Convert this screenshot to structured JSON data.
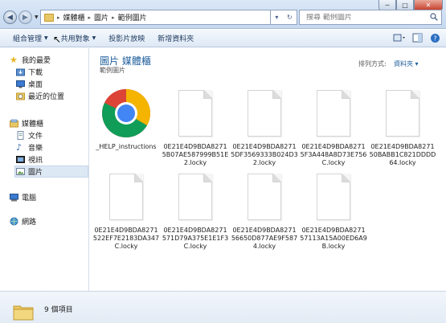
{
  "window": {
    "minimize": "─",
    "maximize": "□",
    "close": "✕"
  },
  "address": {
    "crumbs": [
      "媒體櫃",
      "圖片",
      "範例圖片"
    ],
    "separator": "▸",
    "dropdown": "▾",
    "refresh": "↻"
  },
  "search": {
    "placeholder": "搜尋 範例圖片"
  },
  "commandbar": {
    "organize": "組合管理",
    "share": "共用對象",
    "slideshow": "投影片放映",
    "new_folder": "新增資料夾"
  },
  "sidebar": {
    "favorites": "我的最愛",
    "downloads": "下載",
    "desktop": "桌面",
    "recent": "最近的位置",
    "libraries": "媒體櫃",
    "documents": "文件",
    "music": "音樂",
    "videos": "視訊",
    "pictures": "圖片",
    "computer": "電腦",
    "network": "網路"
  },
  "main": {
    "title": "圖片 媒體櫃",
    "subtitle": "範例圖片",
    "arrange_label": "排列方式:",
    "arrange_value": "資料夾 ▾"
  },
  "files": [
    {
      "name": "_HELP_instructions",
      "icon": "chrome-icon"
    },
    {
      "name": "0E21E4D9BDA82715B07AE587999B51E2.locky",
      "icon": "document-icon"
    },
    {
      "name": "0E21E4D9BDA82715DF3569333B024D32.locky",
      "icon": "document-icon"
    },
    {
      "name": "0E21E4D9BDA82715F3A448A8D73E756C.locky",
      "icon": "document-icon"
    },
    {
      "name": "0E21E4D9BDA827150BABB1C821DDDD64.locky",
      "icon": "document-icon"
    },
    {
      "name": "0E21E4D9BDA8271522EF7E2183DA347C.locky",
      "icon": "document-icon"
    },
    {
      "name": "0E21E4D9BDA8271571D79A375E1E1F3C.locky",
      "icon": "document-icon"
    },
    {
      "name": "0E21E4D9BDA827156650D877AE9F5874.locky",
      "icon": "document-icon"
    },
    {
      "name": "0E21E4D9BDA827157113A15A00ED6A9B.locky",
      "icon": "document-icon"
    }
  ],
  "status": {
    "count": "9 個項目"
  }
}
